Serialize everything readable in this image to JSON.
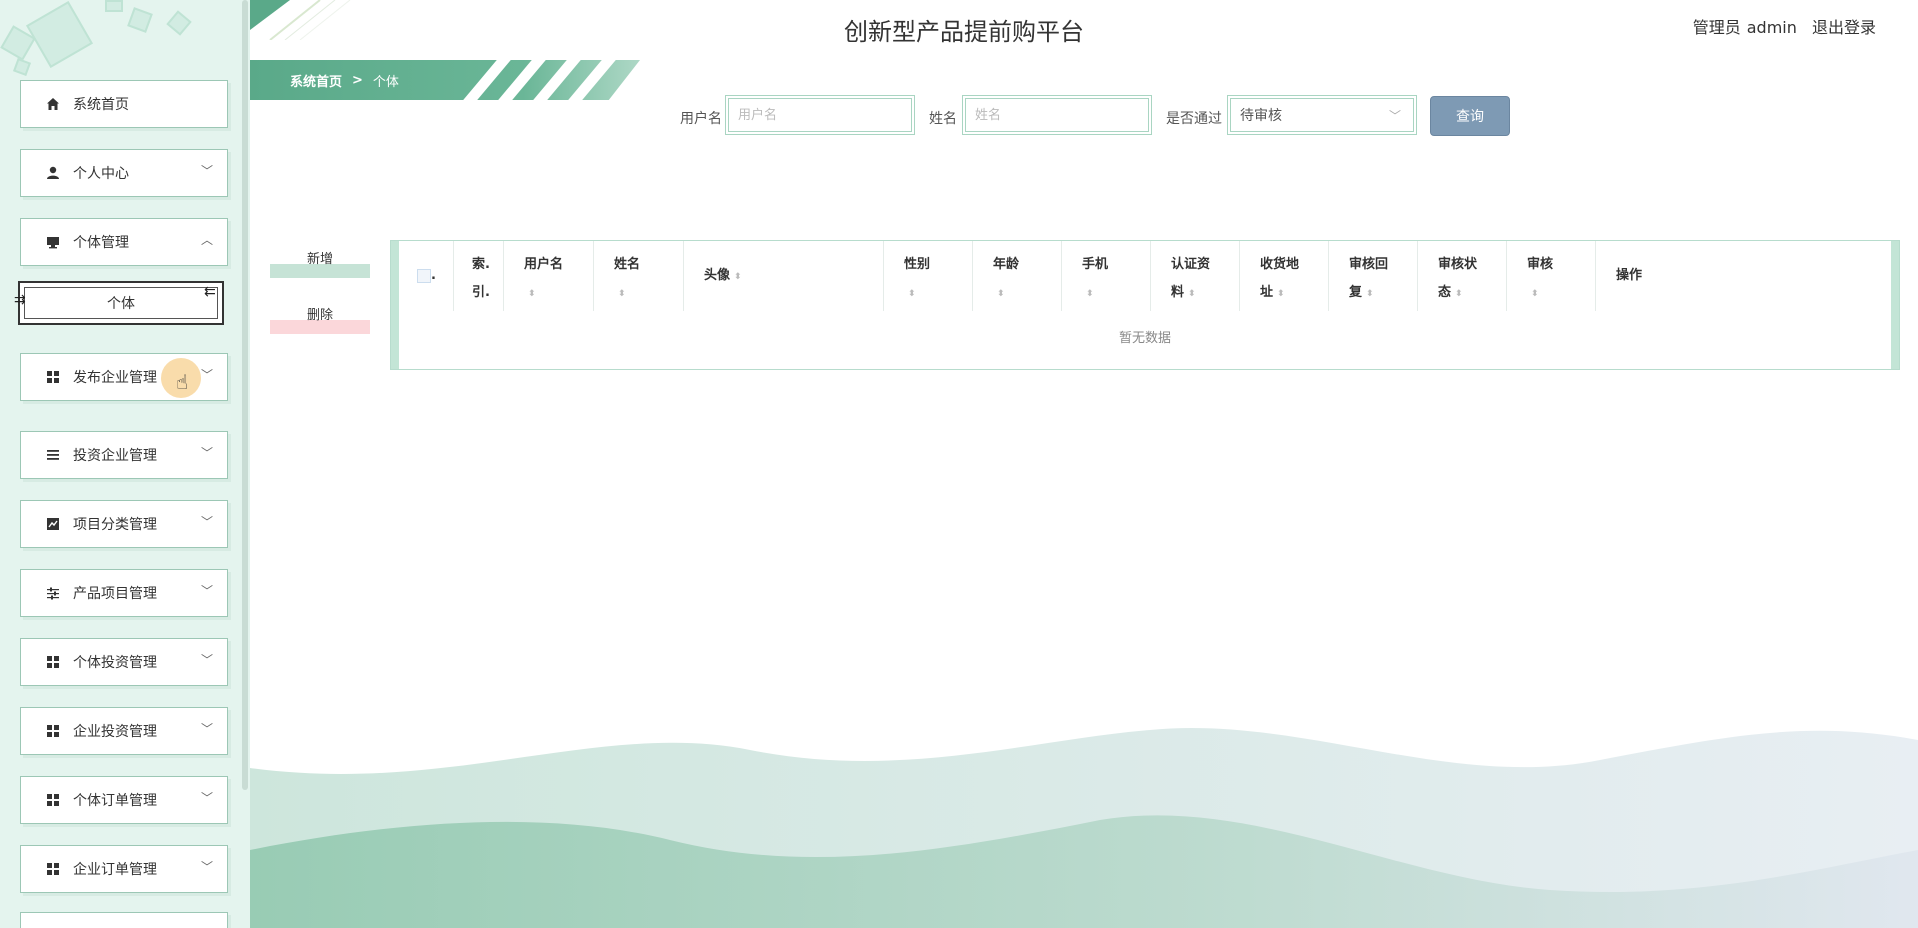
{
  "app": {
    "title": "创新型产品提前购平台"
  },
  "header": {
    "role_label": "管理员",
    "username": "admin",
    "logout_label": "退出登录"
  },
  "sidebar": {
    "items": [
      {
        "label": "系统首页",
        "icon": "home-icon",
        "expandable": false
      },
      {
        "label": "个人中心",
        "icon": "person-icon",
        "expandable": true
      },
      {
        "label": "个体管理",
        "icon": "monitor-icon",
        "expandable": true,
        "expanded": true
      },
      {
        "label": "发布企业管理",
        "icon": "grid-icon",
        "expandable": true
      },
      {
        "label": "投资企业管理",
        "icon": "list-icon",
        "expandable": true
      },
      {
        "label": "项目分类管理",
        "icon": "chart-icon",
        "expandable": true
      },
      {
        "label": "产品项目管理",
        "icon": "sliders-icon",
        "expandable": true
      },
      {
        "label": "个体投资管理",
        "icon": "grid-icon",
        "expandable": true
      },
      {
        "label": "企业投资管理",
        "icon": "grid-icon",
        "expandable": true
      },
      {
        "label": "个体订单管理",
        "icon": "grid-icon",
        "expandable": true
      },
      {
        "label": "企业订单管理",
        "icon": "grid-icon",
        "expandable": true
      }
    ],
    "submenu_individual": "个体"
  },
  "breadcrumb": {
    "home": "系统首页",
    "separator": ">",
    "current": "个体"
  },
  "search": {
    "username_label": "用户名",
    "username_placeholder": "用户名",
    "name_label": "姓名",
    "name_placeholder": "姓名",
    "approved_label": "是否通过",
    "approved_value": "待审核",
    "query_label": "查询"
  },
  "actions": {
    "add_label": "新增",
    "delete_label": "删除"
  },
  "table": {
    "columns": [
      {
        "label": "."
      },
      {
        "label1": "索.",
        "label2": "引."
      },
      {
        "label1": "用户名"
      },
      {
        "label1": "姓名"
      },
      {
        "label1": "头像"
      },
      {
        "label1": "性别"
      },
      {
        "label1": "年龄"
      },
      {
        "label1": "手机"
      },
      {
        "label1": "认证资",
        "label2": "料"
      },
      {
        "label1": "收货地",
        "label2": "址"
      },
      {
        "label1": "审核回",
        "label2": "复"
      },
      {
        "label1": "审核状",
        "label2": "态"
      },
      {
        "label1": "审核"
      },
      {
        "label1": "操作"
      }
    ],
    "empty_text": "暂无数据"
  },
  "colors": {
    "accent": "#5aa989",
    "sidebar_bg": "#e4f4ee",
    "query_button": "#7e9ab4",
    "add_bar": "#c6e3d6",
    "delete_bar": "#fbd7da"
  }
}
